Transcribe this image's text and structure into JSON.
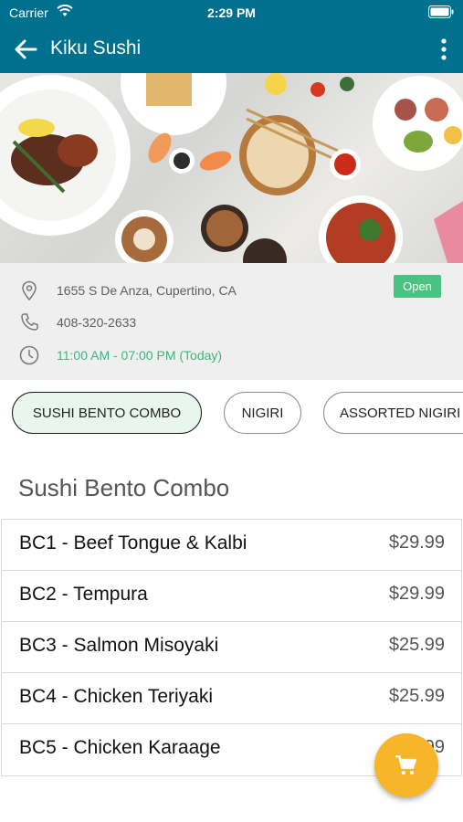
{
  "status_bar": {
    "carrier": "Carrier",
    "time": "2:29 PM"
  },
  "nav": {
    "title": "Kiku Sushi"
  },
  "restaurant": {
    "address": "1655 S De Anza, Cupertino, CA",
    "phone": "408-320-2633",
    "hours": "11:00 AM - 07:00 PM (Today)",
    "status": "Open"
  },
  "tabs": [
    {
      "label": "SUSHI BENTO COMBO",
      "active": true
    },
    {
      "label": "NIGIRI",
      "active": false
    },
    {
      "label": "ASSORTED NIGIRI",
      "active": false
    }
  ],
  "section": {
    "title": "Sushi Bento Combo"
  },
  "menu_items": [
    {
      "name": "BC1 - Beef Tongue & Kalbi",
      "price": "$29.99"
    },
    {
      "name": "BC2 - Tempura",
      "price": "$29.99"
    },
    {
      "name": "BC3 - Salmon Misoyaki",
      "price": "$25.99"
    },
    {
      "name": "BC4 - Chicken Teriyaki",
      "price": "$25.99"
    },
    {
      "name": "BC5 - Chicken Karaage",
      "price": "$29.99"
    }
  ],
  "colors": {
    "header": "#00708f",
    "accent_green": "#4cc282",
    "cart_button": "#f7b52a"
  },
  "icons": [
    "wifi-icon",
    "battery-icon",
    "back-arrow-icon",
    "more-vertical-icon",
    "location-pin-icon",
    "phone-icon",
    "clock-icon",
    "cart-icon"
  ]
}
